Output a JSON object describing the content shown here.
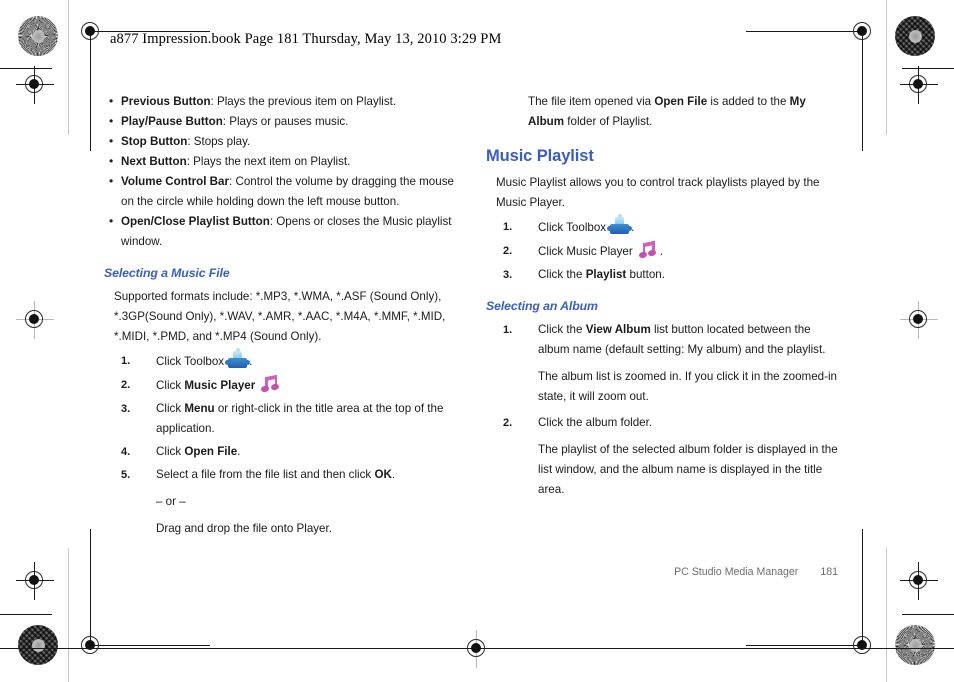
{
  "header": {
    "running_head": "a877 Impression.book  Page 181  Thursday, May 13, 2010  3:29 PM"
  },
  "colors": {
    "heading_blue": "#3a5dc0",
    "body_black": "#1b1b1b",
    "footer_gray": "#6d6d6d",
    "puzzle_icon_blue": "#1f5fae",
    "puzzle_icon_cyan": "#7ec8e8",
    "music_note_magenta": "#c44fae"
  },
  "left_column": {
    "bullets": [
      {
        "term": "Previous Button",
        "rest": ": Plays the previous item on Playlist."
      },
      {
        "term": "Play/Pause Button",
        "rest": ": Plays or pauses music."
      },
      {
        "term": "Stop Button",
        "rest": ": Stops play."
      },
      {
        "term": "Next Button",
        "rest": ": Plays the next item on Playlist."
      },
      {
        "term": "Volume Control Bar",
        "rest": ": Control the volume by dragging the mouse on the circle while holding down the left mouse button."
      },
      {
        "term": "Open/Close Playlist Button",
        "rest": ": Opens or closes the Music playlist window."
      }
    ],
    "subheading": "Selecting a Music File",
    "formats_paragraph": "Supported formats include: *.MP3, *.WMA, *.ASF (Sound Only), *.3GP(Sound Only), *.WAV, *.AMR, *.AAC, *.M4A, *.MMF, *.MID, *.MIDI, *.PMD, and *.MP4 (Sound Only).",
    "steps": [
      {
        "number": "1.",
        "pre": "Click Toolbox",
        "icon": "puzzle-piece-icon",
        "post": "."
      },
      {
        "number": "2.",
        "pre": "Click ",
        "bold": "Music Player",
        "icon": "music-note-icon",
        "post": ""
      },
      {
        "number": "3.",
        "pre": "Click ",
        "bold": "Menu",
        "post": " or right-click in the title area at the top of the application."
      },
      {
        "number": "4.",
        "pre": "Click ",
        "bold": "Open File",
        "post": "."
      },
      {
        "number": "5.",
        "pre": "Select a file from the file list and then click ",
        "bold": "OK",
        "post": ".",
        "sub_lines": [
          "– or –",
          "Drag and drop the file onto Player."
        ]
      }
    ]
  },
  "right_column": {
    "intro": {
      "pre": "The file item opened via ",
      "bold1": "Open File",
      "mid": " is added to the ",
      "bold2": "My Album",
      "post": " folder of Playlist."
    },
    "section_heading": "Music Playlist",
    "section_paragraph": "Music Playlist allows you to control track playlists played by the Music Player.",
    "steps": [
      {
        "number": "1.",
        "pre": "Click Toolbox",
        "icon": "puzzle-piece-icon",
        "post": "."
      },
      {
        "number": "2.",
        "pre": "Click Music Player",
        "icon": "music-note-icon",
        "post": "."
      },
      {
        "number": "3.",
        "pre": "Click the ",
        "bold": "Playlist",
        "post": " button."
      }
    ],
    "subheading": "Selecting an Album",
    "album_steps": [
      {
        "number": "1.",
        "pre": "Click the ",
        "bold": "View Album",
        "post": " list button located between the album name (default setting: My album) and the playlist.",
        "sub_lines": [
          "The album list is zoomed in. If you click it in the zoomed-in state, it will zoom out."
        ]
      },
      {
        "number": "2.",
        "pre": "Click the album folder.",
        "sub_lines": [
          "The playlist of the selected album folder is displayed in the list window, and the album name is displayed in the title area."
        ]
      }
    ]
  },
  "footer": {
    "title": "PC Studio Media Manager",
    "page_number": "181"
  }
}
